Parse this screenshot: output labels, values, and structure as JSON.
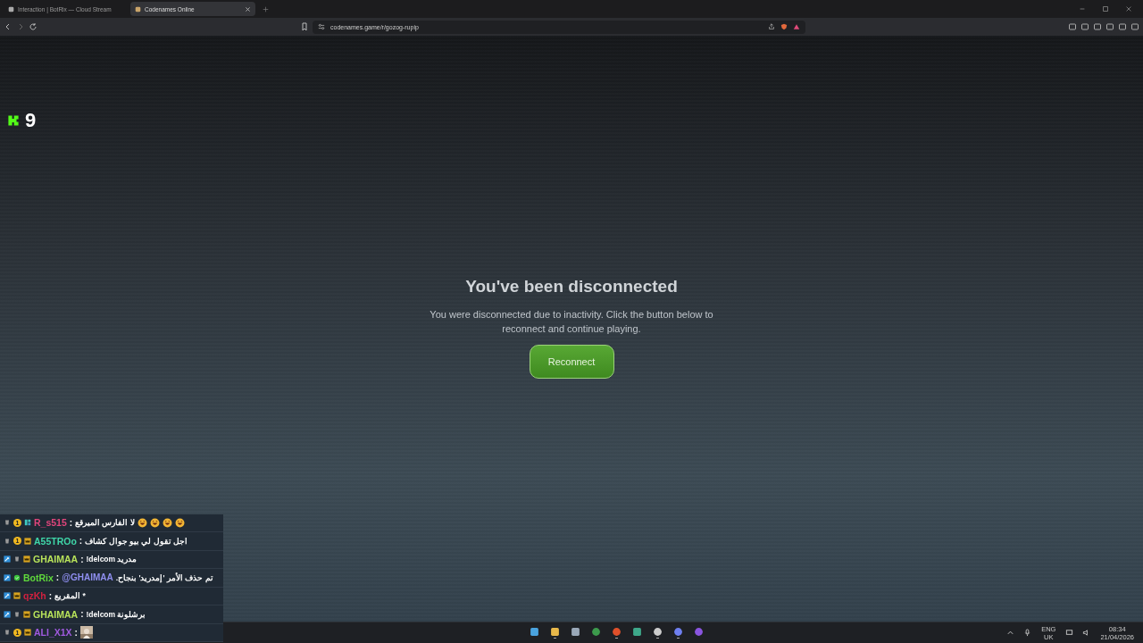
{
  "browser": {
    "tabs": [
      {
        "title": "Interaction | BotRix — Cloud Stream",
        "selected": false
      },
      {
        "title": "Codenames Online",
        "selected": true
      }
    ],
    "url": "codenames.game/r/gozog-rupip"
  },
  "overlay_counter": "9",
  "dialog": {
    "title": "You've been disconnected",
    "message": "You were disconnected due to inactivity. Click the button below to reconnect and continue playing.",
    "button": "Reconnect"
  },
  "chat": [
    {
      "badges": [
        {
          "kind": "cup"
        },
        {
          "kind": "tier",
          "label": "1"
        },
        {
          "kind": "gift"
        }
      ],
      "user": "R_s515",
      "color": "#e0457b",
      "separator": ":",
      "text": "لا الفارس الميرقع",
      "emotes": [
        {
          "kind": "laugh"
        },
        {
          "kind": "laugh"
        },
        {
          "kind": "laugh"
        },
        {
          "kind": "laugh"
        }
      ]
    },
    {
      "badges": [
        {
          "kind": "cup"
        },
        {
          "kind": "tier",
          "label": "1"
        },
        {
          "kind": "crown"
        }
      ],
      "user": "A55TROo",
      "color": "#3fd6a8",
      "separator": ":",
      "text": "اجل تقول لي بيو جوال كشاف"
    },
    {
      "badges": [
        {
          "kind": "mod"
        },
        {
          "kind": "cup"
        },
        {
          "kind": "crown"
        }
      ],
      "user": "GHAIMAA",
      "color": "#b8e35a",
      "separator": ":",
      "text": "!delcom مدريد"
    },
    {
      "badges": [
        {
          "kind": "mod"
        },
        {
          "kind": "verified"
        }
      ],
      "user": "BotRix",
      "color": "#5fd83c",
      "separator": ":",
      "mention": "@GHAIMAA",
      "text": "تم حذف الأمر 'إمدريد' بنجاح."
    },
    {
      "badges": [
        {
          "kind": "mod"
        },
        {
          "kind": "crown"
        }
      ],
      "user": "qzKh",
      "color": "#d0213f",
      "separator": ":",
      "text": "* المقريع"
    },
    {
      "badges": [
        {
          "kind": "mod"
        },
        {
          "kind": "cup"
        },
        {
          "kind": "crown"
        }
      ],
      "user": "GHAIMAA",
      "color": "#b8e35a",
      "separator": ":",
      "text": "!delcom برشلونة"
    },
    {
      "badges": [
        {
          "kind": "cup"
        },
        {
          "kind": "tier",
          "label": "1"
        },
        {
          "kind": "crown"
        }
      ],
      "user": "ALI_X1X",
      "color": "#a05ae0",
      "separator": ":",
      "emote_picture": {
        "kind": "picture"
      }
    }
  ],
  "taskbar": {
    "apps": [
      {
        "kind": "windows",
        "selected": false
      },
      {
        "kind": "folder",
        "selected": true
      },
      {
        "kind": "store",
        "selected": false
      },
      {
        "kind": "chrome",
        "selected": false
      },
      {
        "kind": "brave",
        "selected": true
      },
      {
        "kind": "terminal",
        "selected": false
      },
      {
        "kind": "obs",
        "selected": true
      },
      {
        "kind": "discord",
        "selected": true
      },
      {
        "kind": "video",
        "selected": false
      }
    ],
    "language": "ENG",
    "region": "UK",
    "time": "08:34",
    "date": "21/04/2026"
  }
}
